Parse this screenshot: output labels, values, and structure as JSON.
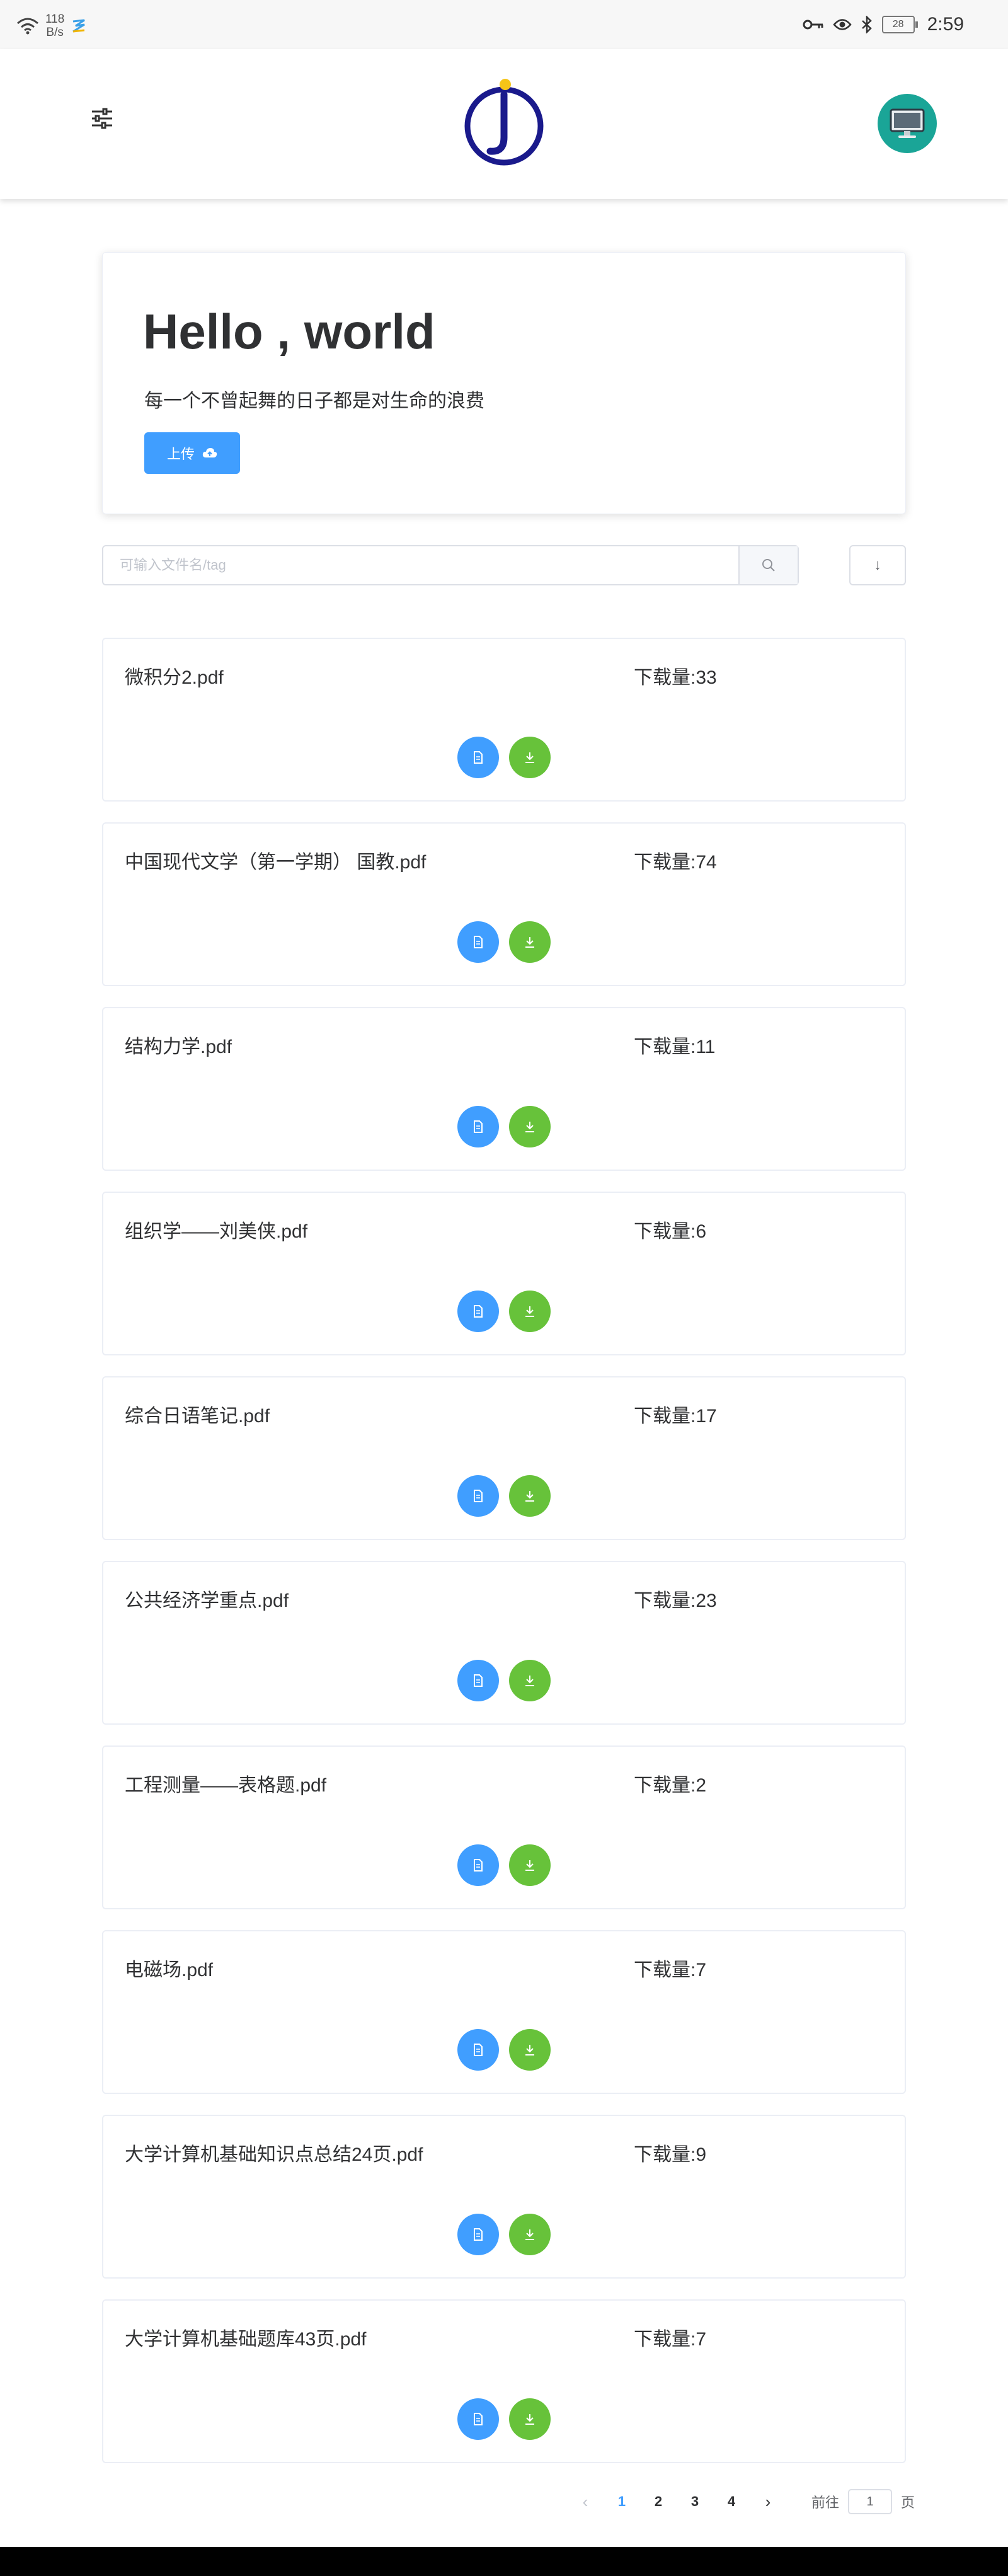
{
  "status_bar": {
    "net_speed_value": "118",
    "net_speed_unit": "B/s",
    "battery": "28",
    "time": "2:59",
    "icons": [
      "wifi-icon",
      "app-icon",
      "key-icon",
      "eye-icon",
      "bluetooth-icon",
      "battery-icon"
    ]
  },
  "header": {
    "menu_icon": "sliders-icon",
    "logo": "j-logo",
    "avatar_icon": "monitor-icon",
    "colors": {
      "logo_navy": "#1a1a8c",
      "logo_dot": "#f5c518",
      "avatar_bg": "#1aa597"
    }
  },
  "hero": {
    "title": "Hello , world",
    "subtitle": "每一个不曾起舞的日子都是对生命的浪费",
    "upload_label": "上传",
    "upload_icon": "cloud-upload-icon"
  },
  "search": {
    "placeholder": "可输入文件名/tag",
    "value": "",
    "search_icon": "search-icon",
    "sort_label": "↓"
  },
  "files": [
    {
      "name": "微积分2.pdf",
      "downloads": "下载量:33"
    },
    {
      "name": "中国现代文学（第一学期） 国教.pdf",
      "downloads": "下载量:74"
    },
    {
      "name": "结构力学.pdf",
      "downloads": "下载量:11"
    },
    {
      "name": "组织学——刘美侠.pdf",
      "downloads": "下载量:6"
    },
    {
      "name": "综合日语笔记.pdf",
      "downloads": "下载量:17"
    },
    {
      "name": "公共经济学重点.pdf",
      "downloads": "下载量:23"
    },
    {
      "name": "工程测量——表格题.pdf",
      "downloads": "下载量:2"
    },
    {
      "name": "电磁场.pdf",
      "downloads": "下载量:7"
    },
    {
      "name": "大学计算机基础知识点总结24页.pdf",
      "downloads": "下载量:9"
    },
    {
      "name": "大学计算机基础题库43页.pdf",
      "downloads": "下载量:7"
    }
  ],
  "file_actions": {
    "preview_icon": "document-icon",
    "download_icon": "download-icon"
  },
  "pagination": {
    "prev": "‹",
    "pages": [
      "1",
      "2",
      "3",
      "4"
    ],
    "current": "1",
    "next": "›",
    "goto_prefix": "前往",
    "goto_value": "1",
    "goto_suffix": "页"
  },
  "colors": {
    "primary": "#409eff",
    "success": "#67c23a",
    "text": "#303133"
  }
}
